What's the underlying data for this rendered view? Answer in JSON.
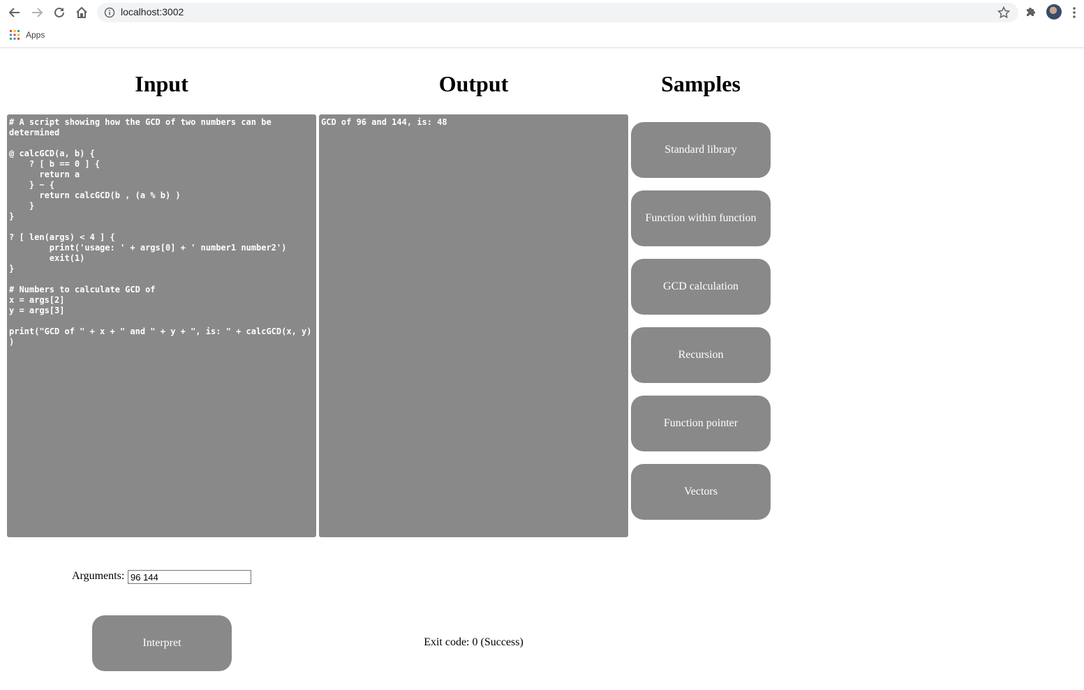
{
  "browser": {
    "url": "localhost:3002",
    "bookmarks": {
      "apps_label": "Apps"
    }
  },
  "headings": {
    "input": "Input",
    "output": "Output",
    "samples": "Samples"
  },
  "input_code": "# A script showing how the GCD of two numbers can be determined\n\n@ calcGCD(a, b) {\n    ? [ b == 0 ] {\n      return a\n    } ~ {\n      return calcGCD(b , (a % b) )\n    }\n}\n\n? [ len(args) < 4 ] {\n        print('usage: ' + args[0] + ' number1 number2')\n        exit(1)\n}\n\n# Numbers to calculate GCD of\nx = args[2]\ny = args[3]\n\nprint(\"GCD of \" + x + \" and \" + y + \", is: \" + calcGCD(x, y) )",
  "output_text": "GCD of 96 and 144, is: 48",
  "samples": [
    "Standard library",
    "Function within function",
    "GCD calculation",
    "Recursion",
    "Function pointer",
    "Vectors"
  ],
  "arguments": {
    "label": "Arguments:",
    "value": "96 144"
  },
  "interpret_label": "Interpret",
  "exit_code": "Exit code: 0 (Success)"
}
